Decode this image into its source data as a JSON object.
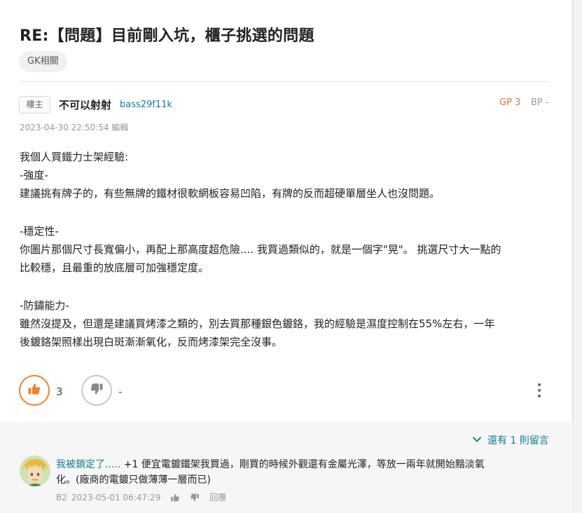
{
  "post": {
    "title": "RE:【問題】目前剛入坑，櫃子挑選的問題",
    "tag": "GK相關",
    "floor_badge": "樓主",
    "author_name": "不可以射射",
    "author_id": "bass29f11k",
    "gp": "GP 3",
    "bp": "BP -",
    "timestamp": "2023-04-30 22:50:54 編輯",
    "body_lines": [
      "我個人買鐵力士架經驗:",
      "-強度-",
      "建議挑有牌子的，有些無牌的鐵材很軟網板容易凹陷，有牌的反而超硬單層坐人也沒問題。",
      "",
      "-穩定性-",
      "你圖片那個尺寸長寬偏小，再配上那高度超危險.... 我買過類似的，就是一個字\"晃\"。 挑選尺寸大一點的",
      "比較穩，且最重的放底層可加強穩定度。",
      "",
      "-防鏽能力-",
      "雖然沒提及，但還是建議買烤漆之類的，別去買那種銀色鍍鉻，我的經驗是濕度控制在55%左右，一年",
      "後鍍鉻架照樣出現白斑漸漸氧化，反而烤漆架完全沒事。"
    ],
    "like_count": "3",
    "dislike_count": "-"
  },
  "comments": {
    "more_label": "還有 1 則留言",
    "items": [
      {
        "author": "我被鎖定了.....",
        "text_line1": " +1 便宜電鍍鐵架我買過，剛買的時候外觀還有金屬光澤，等放一兩年就開始黯淡氧",
        "text_line2": "化。(廠商的電鍍只做薄薄一層而已)",
        "floor": "B2",
        "timestamp": "2023-05-01 06:47:29",
        "reply_label": "回覆"
      }
    ]
  },
  "colors": {
    "accent_orange": "#f0822e",
    "link_teal": "#117e96",
    "gp_orange": "#e5792b"
  },
  "icons": {
    "like": "thumbs-up-icon",
    "dislike": "thumbs-down-icon",
    "more": "more-vertical-icon",
    "expand": "chevron-down-icon"
  }
}
